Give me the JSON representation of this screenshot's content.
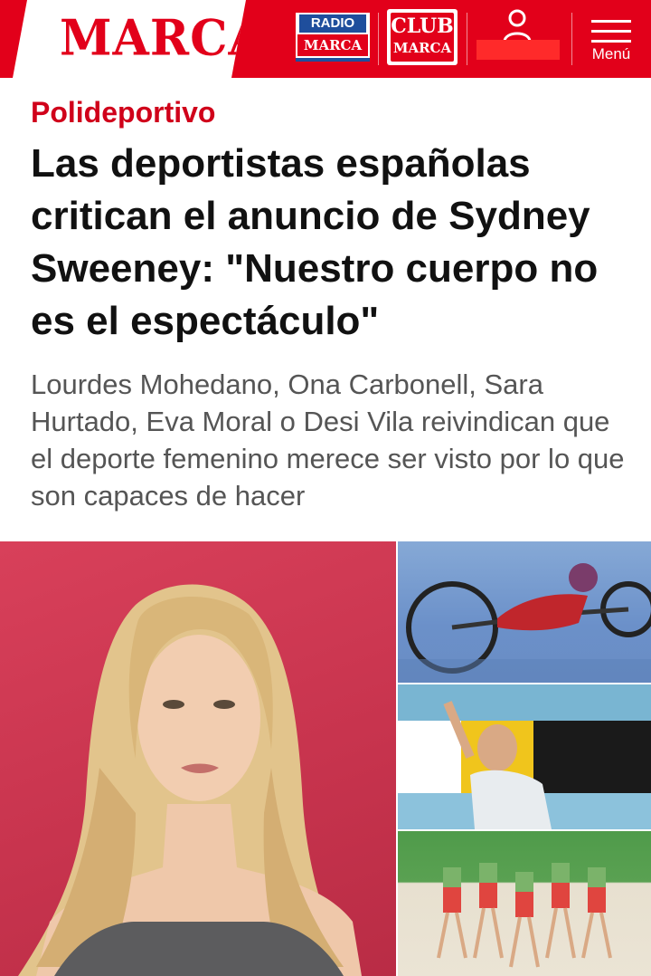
{
  "header": {
    "logo_text": "MARCA",
    "radio_badge": {
      "top": "RADIO",
      "bottom": "MARCA"
    },
    "club_badge": {
      "line1": "CLUB",
      "line2": "MARCA"
    },
    "menu_label": "Menú",
    "brand_color": "#e2001a",
    "icons": [
      "user-icon",
      "hamburger-menu-icon"
    ]
  },
  "article": {
    "section": "Polideportivo",
    "title": "Las deportistas españolas critican el anuncio de Sydney Sweeney: \"Nuestro cuerpo no es el espectáculo\"",
    "subtitle": "Lourdes Mohedano, Ona Carbonell, Sara Hurtado, Eva Moral o Desi Vila reivindican que el deporte femenino merece ser visto por lo que son capaces de hacer",
    "section_color": "#d0001a"
  }
}
